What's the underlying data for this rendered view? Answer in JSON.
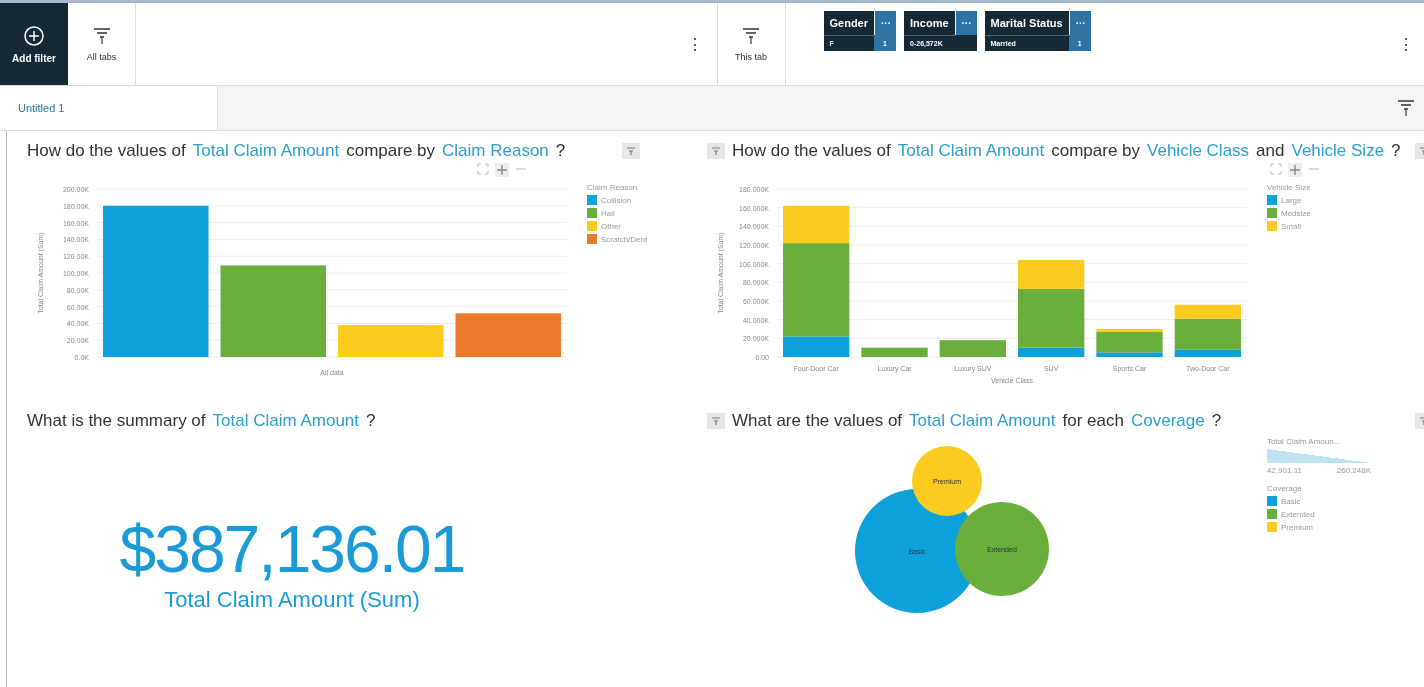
{
  "toolbar": {
    "add_filter": "Add filter",
    "all_tabs": "All tabs",
    "this_tab": "This tab",
    "more": "⋮",
    "filters": [
      {
        "name": "Gender",
        "menu": "···",
        "value": "F",
        "count": "1"
      },
      {
        "name": "Income",
        "menu": "···",
        "value": "0-26,572K"
      },
      {
        "name": "Marital Status",
        "menu": "···",
        "value": "Married",
        "count": "1"
      }
    ],
    "right_more": "⋮"
  },
  "tabs": [
    {
      "label": "Untitled 1",
      "selected": true
    }
  ],
  "panels": [
    {
      "kind": "bar",
      "title": [
        {
          "text": "How do the values of",
          "field": false
        },
        {
          "text": "Total Claim Amount",
          "field": true
        },
        {
          "text": "compare by",
          "field": false
        },
        {
          "text": "Claim Reason",
          "field": true
        },
        {
          "text": "?",
          "field": false
        }
      ],
      "legend_title": "Claim Reason",
      "chart_data": {
        "type": "bar",
        "ylabel": "Total Claim Amount (Sum)",
        "categories": [
          "All data"
        ],
        "series": [
          {
            "name": "Collision",
            "color": "#0ea0db",
            "values": [
              180
            ]
          },
          {
            "name": "Hail",
            "color": "#6aae3b",
            "values": [
              109
            ]
          },
          {
            "name": "Other",
            "color": "#fccb1f",
            "values": [
              38
            ]
          },
          {
            "name": "Scratch/Dent",
            "color": "#ea7a2c",
            "values": [
              52
            ]
          }
        ],
        "ylim": [
          0,
          200
        ],
        "grid": true,
        "yticks": [
          {
            "value": 0,
            "label": "0.0K"
          },
          {
            "value": 20,
            "label": "20.00K"
          },
          {
            "value": 40,
            "label": "40.00K"
          },
          {
            "value": 60,
            "label": "60.00K"
          },
          {
            "value": 80,
            "label": "80.00K"
          },
          {
            "value": 100,
            "label": "100.00K"
          },
          {
            "value": 120,
            "label": "120.00K"
          },
          {
            "value": 140,
            "label": "140.00K"
          },
          {
            "value": 160,
            "label": "160.00K"
          },
          {
            "value": 180,
            "label": "180.00K"
          },
          {
            "value": 200,
            "label": "200.00K"
          }
        ]
      }
    },
    {
      "kind": "stacked",
      "title": [
        {
          "text": "How do the values of",
          "field": false
        },
        {
          "text": "Total Claim Amount",
          "field": true
        },
        {
          "text": "compare by",
          "field": false
        },
        {
          "text": "Vehicle Class",
          "field": true
        },
        {
          "text": "and",
          "field": false
        },
        {
          "text": "Vehicle Size",
          "field": true
        },
        {
          "text": "?",
          "field": false
        }
      ],
      "legend_title": "Vehicle Size",
      "chart_data": {
        "type": "bar",
        "stacked": true,
        "xlabel": "Vehicle Class",
        "ylabel": "Total Claim Amount (Sum)",
        "categories": [
          "Four-Door Car",
          "Luxury Car",
          "Luxury SUV",
          "SUV",
          "Sports Car",
          "Two-Door Car"
        ],
        "series": [
          {
            "name": "Large",
            "color": "#0ea0db",
            "values": [
              22,
              0,
              0,
              10,
              5,
              8
            ]
          },
          {
            "name": "Medsize",
            "color": "#6aae3b",
            "values": [
              100,
              10,
              18,
              63,
              22,
              33
            ]
          },
          {
            "name": "Small",
            "color": "#fccb1f",
            "values": [
              40,
              0,
              0,
              31,
              3,
              15
            ]
          }
        ],
        "ylim": [
          0,
          180
        ],
        "grid": true,
        "yticks": [
          {
            "value": 0,
            "label": "0.00"
          },
          {
            "value": 20,
            "label": "20.000K"
          },
          {
            "value": 40,
            "label": "40.000K"
          },
          {
            "value": 60,
            "label": "60.000K"
          },
          {
            "value": 80,
            "label": "80.000K"
          },
          {
            "value": 100,
            "label": "100.000K"
          },
          {
            "value": 120,
            "label": "120.000K"
          },
          {
            "value": 140,
            "label": "140.000K"
          },
          {
            "value": 160,
            "label": "160.000K"
          },
          {
            "value": 180,
            "label": "180.000K"
          }
        ]
      }
    },
    {
      "kind": "summary",
      "title": [
        {
          "text": "What is the summary of",
          "field": false
        },
        {
          "text": "Total Claim Amount",
          "field": true
        },
        {
          "text": "?",
          "field": false
        }
      ],
      "value": "$387,136.01",
      "caption": "Total Claim Amount (Sum)"
    },
    {
      "kind": "bubble",
      "title": [
        {
          "text": "What are the values of",
          "field": false
        },
        {
          "text": "Total Claim Amount",
          "field": true
        },
        {
          "text": "for each",
          "field": false
        },
        {
          "text": "Coverage",
          "field": true
        },
        {
          "text": "?",
          "field": false
        }
      ],
      "size_legend": {
        "title": "Total Claim Amoun...",
        "min": "42,901.11",
        "max": "260,248K"
      },
      "legend_title": "Coverage",
      "legend": [
        {
          "label": "Basic",
          "color": "#0ea0db"
        },
        {
          "label": "Extended",
          "color": "#6aae3b"
        },
        {
          "label": "Premium",
          "color": "#fccb1f"
        }
      ],
      "bubbles": [
        {
          "label": "Basic",
          "color": "#0ea0db"
        },
        {
          "label": "Extended",
          "color": "#6aae3b"
        },
        {
          "label": "Premium",
          "color": "#fccb1f"
        }
      ]
    }
  ]
}
